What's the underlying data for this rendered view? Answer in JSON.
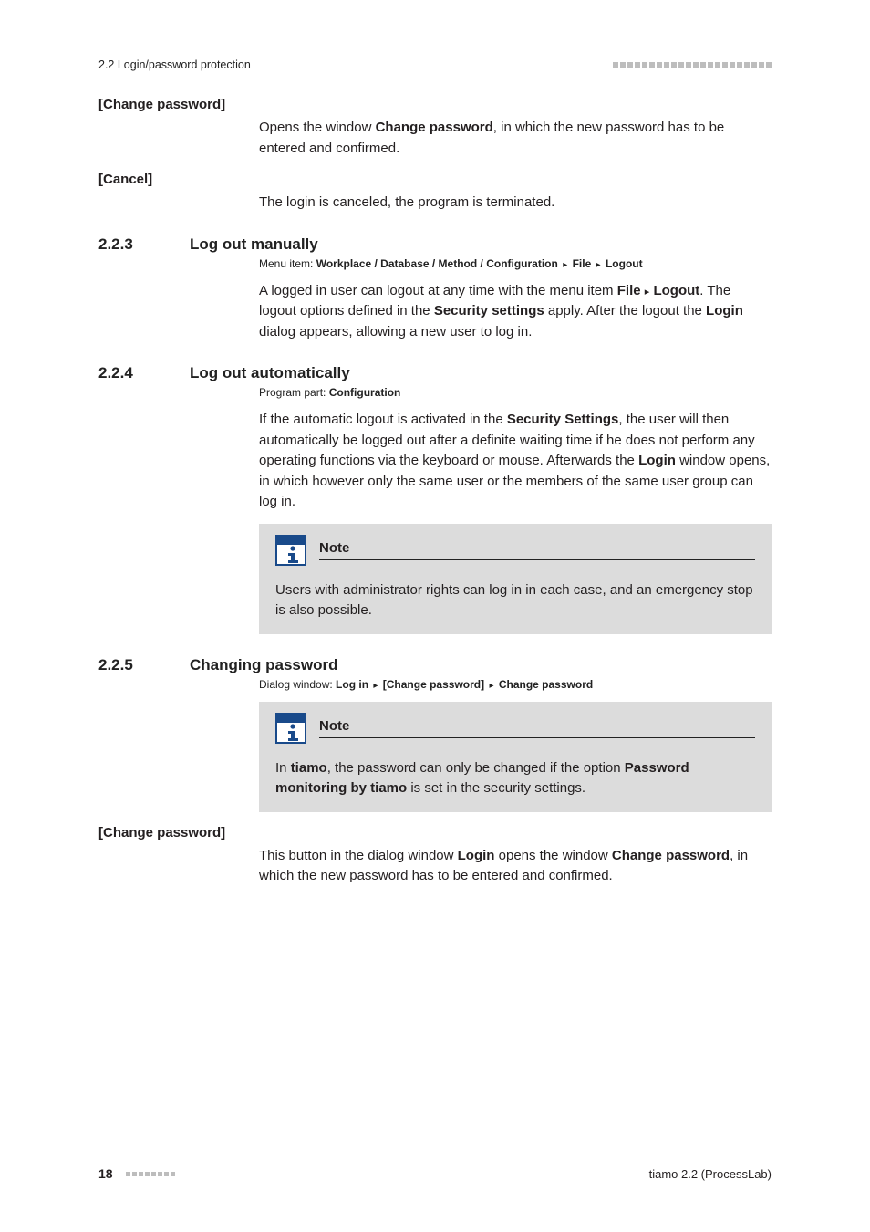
{
  "header": {
    "left": "2.2 Login/password protection"
  },
  "s_change_pw_1": {
    "label": "[Change password]",
    "para_pre": "Opens the window ",
    "para_b": "Change password",
    "para_post": ", in which the new password has to be entered and confirmed."
  },
  "s_cancel": {
    "label": "[Cancel]",
    "para": "The login is canceled, the program is terminated."
  },
  "sec_223": {
    "num": "2.2.3",
    "title": "Log out manually",
    "meta_pre": "Menu item: ",
    "meta_b1": "Workplace / Database / Method / Configuration",
    "meta_b2": "File",
    "meta_b3": "Logout",
    "p1_a": "A logged in user can logout at any time with the menu item ",
    "p1_b": "File",
    "p1_c": "Log­out",
    "p1_d": ". The logout options defined in the ",
    "p1_e": "Security settings",
    "p1_f": " apply. After the logout the ",
    "p1_g": "Login",
    "p1_h": " dialog appears, allowing a new user to log in."
  },
  "sec_224": {
    "num": "2.2.4",
    "title": "Log out automatically",
    "meta_pre": "Program part: ",
    "meta_b": "Configuration",
    "p_a": "If the automatic logout is activated in the ",
    "p_b": "Security Settings",
    "p_c": ", the user will then automatically be logged out after a definite waiting time if he does not perform any operating functions via the keyboard or mouse. Afterwards the ",
    "p_d": "Login",
    "p_e": " window opens, in which however only the same user or the members of the same user group can log in.",
    "note_title": "Note",
    "note_body": "Users with administrator rights can log in in each case, and an emergency stop is also possible."
  },
  "sec_225": {
    "num": "2.2.5",
    "title": "Changing password",
    "meta_pre": "Dialog window: ",
    "meta_b1": "Log in",
    "meta_b2": "[Change password]",
    "meta_b3": "Change password",
    "note_title": "Note",
    "note_a": "In ",
    "note_b": "tiamo",
    "note_c": ", the password can only be changed if the option ",
    "note_d": "Password monitoring by tiamo",
    "note_e": " is set in the security settings.",
    "label2": "[Change password]",
    "p2_a": "This button in the dialog window ",
    "p2_b": "Login",
    "p2_c": " opens the window ",
    "p2_d": "Change pass­word",
    "p2_e": ", in which the new password has to be entered and confirmed."
  },
  "footer": {
    "page": "18",
    "right": "tiamo 2.2 (ProcessLab)"
  },
  "tri": "▸"
}
